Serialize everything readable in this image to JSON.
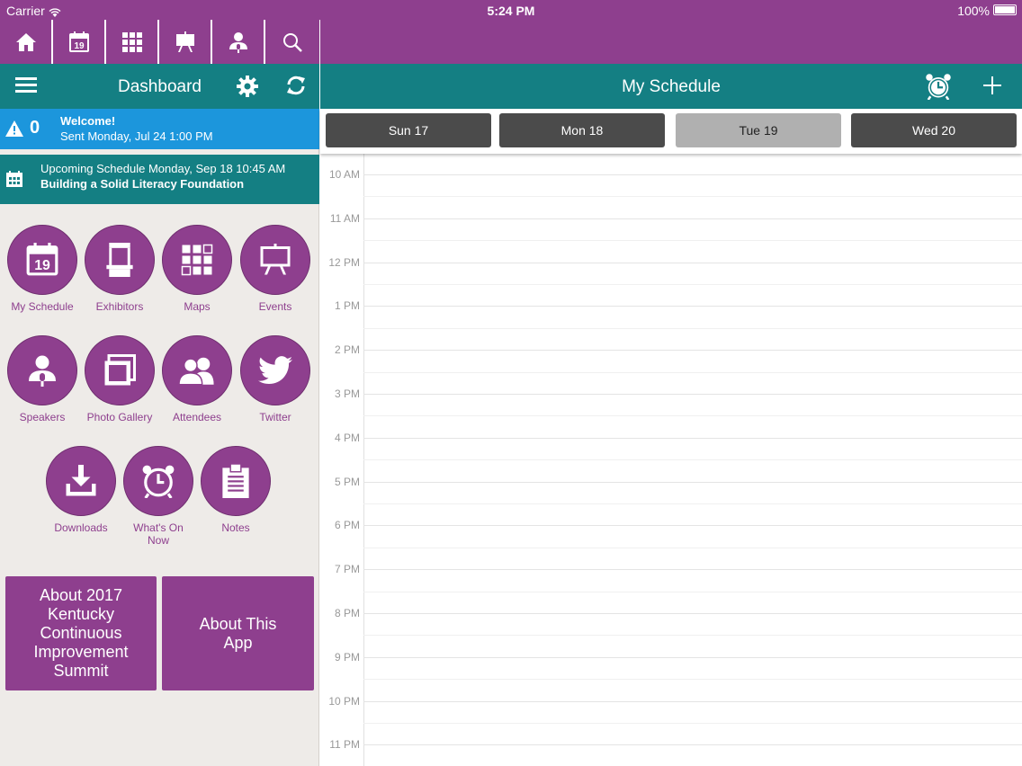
{
  "status": {
    "carrier": "Carrier",
    "time": "5:24 PM",
    "battery": "100%"
  },
  "topnav": [
    {
      "icon": "home-icon"
    },
    {
      "icon": "calendar-icon",
      "text": "19"
    },
    {
      "icon": "grid-map-icon"
    },
    {
      "icon": "easel-icon"
    },
    {
      "icon": "speaker-icon"
    },
    {
      "icon": "search-icon"
    }
  ],
  "dashboard": {
    "title": "Dashboard"
  },
  "alert": {
    "count": "0",
    "title": "Welcome!",
    "subtitle": "Sent Monday, Jul 24 1:00 PM"
  },
  "upcoming": {
    "line1": "Upcoming Schedule Monday, Sep 18 10:45 AM",
    "line2": "Building a Solid Literacy Foundation"
  },
  "tiles": [
    {
      "label": "My Schedule",
      "icon": "calendar-icon",
      "text": "19"
    },
    {
      "label": "Exhibitors",
      "icon": "booth-icon"
    },
    {
      "label": "Maps",
      "icon": "grid-map-icon"
    },
    {
      "label": "Events",
      "icon": "easel-icon"
    },
    {
      "label": "Speakers",
      "icon": "speaker-icon"
    },
    {
      "label": "Photo Gallery",
      "icon": "photo-gallery-icon"
    },
    {
      "label": "Attendees",
      "icon": "attendees-icon"
    },
    {
      "label": "Twitter",
      "icon": "twitter-icon"
    },
    {
      "label": "Downloads",
      "icon": "download-icon"
    },
    {
      "label": "What's On Now",
      "icon": "alarm-clock-icon"
    },
    {
      "label": "Notes",
      "icon": "clipboard-icon"
    }
  ],
  "buttons": {
    "about_event": "About 2017 Kentucky Continuous Improvement Summit",
    "about_app": "About This App"
  },
  "schedule": {
    "title": "My Schedule",
    "days": [
      "Sun 17",
      "Mon 18",
      "Tue 19",
      "Wed 20"
    ],
    "selected_day": "Tue 19",
    "hours": [
      "10 AM",
      "11 AM",
      "12 PM",
      "1 PM",
      "2 PM",
      "3 PM",
      "4 PM",
      "5 PM",
      "6 PM",
      "7 PM",
      "8 PM",
      "9 PM",
      "10 PM",
      "11 PM"
    ]
  },
  "colors": {
    "purple": "#8e3f8e",
    "teal": "#147f83",
    "blue": "#1c96dc"
  }
}
